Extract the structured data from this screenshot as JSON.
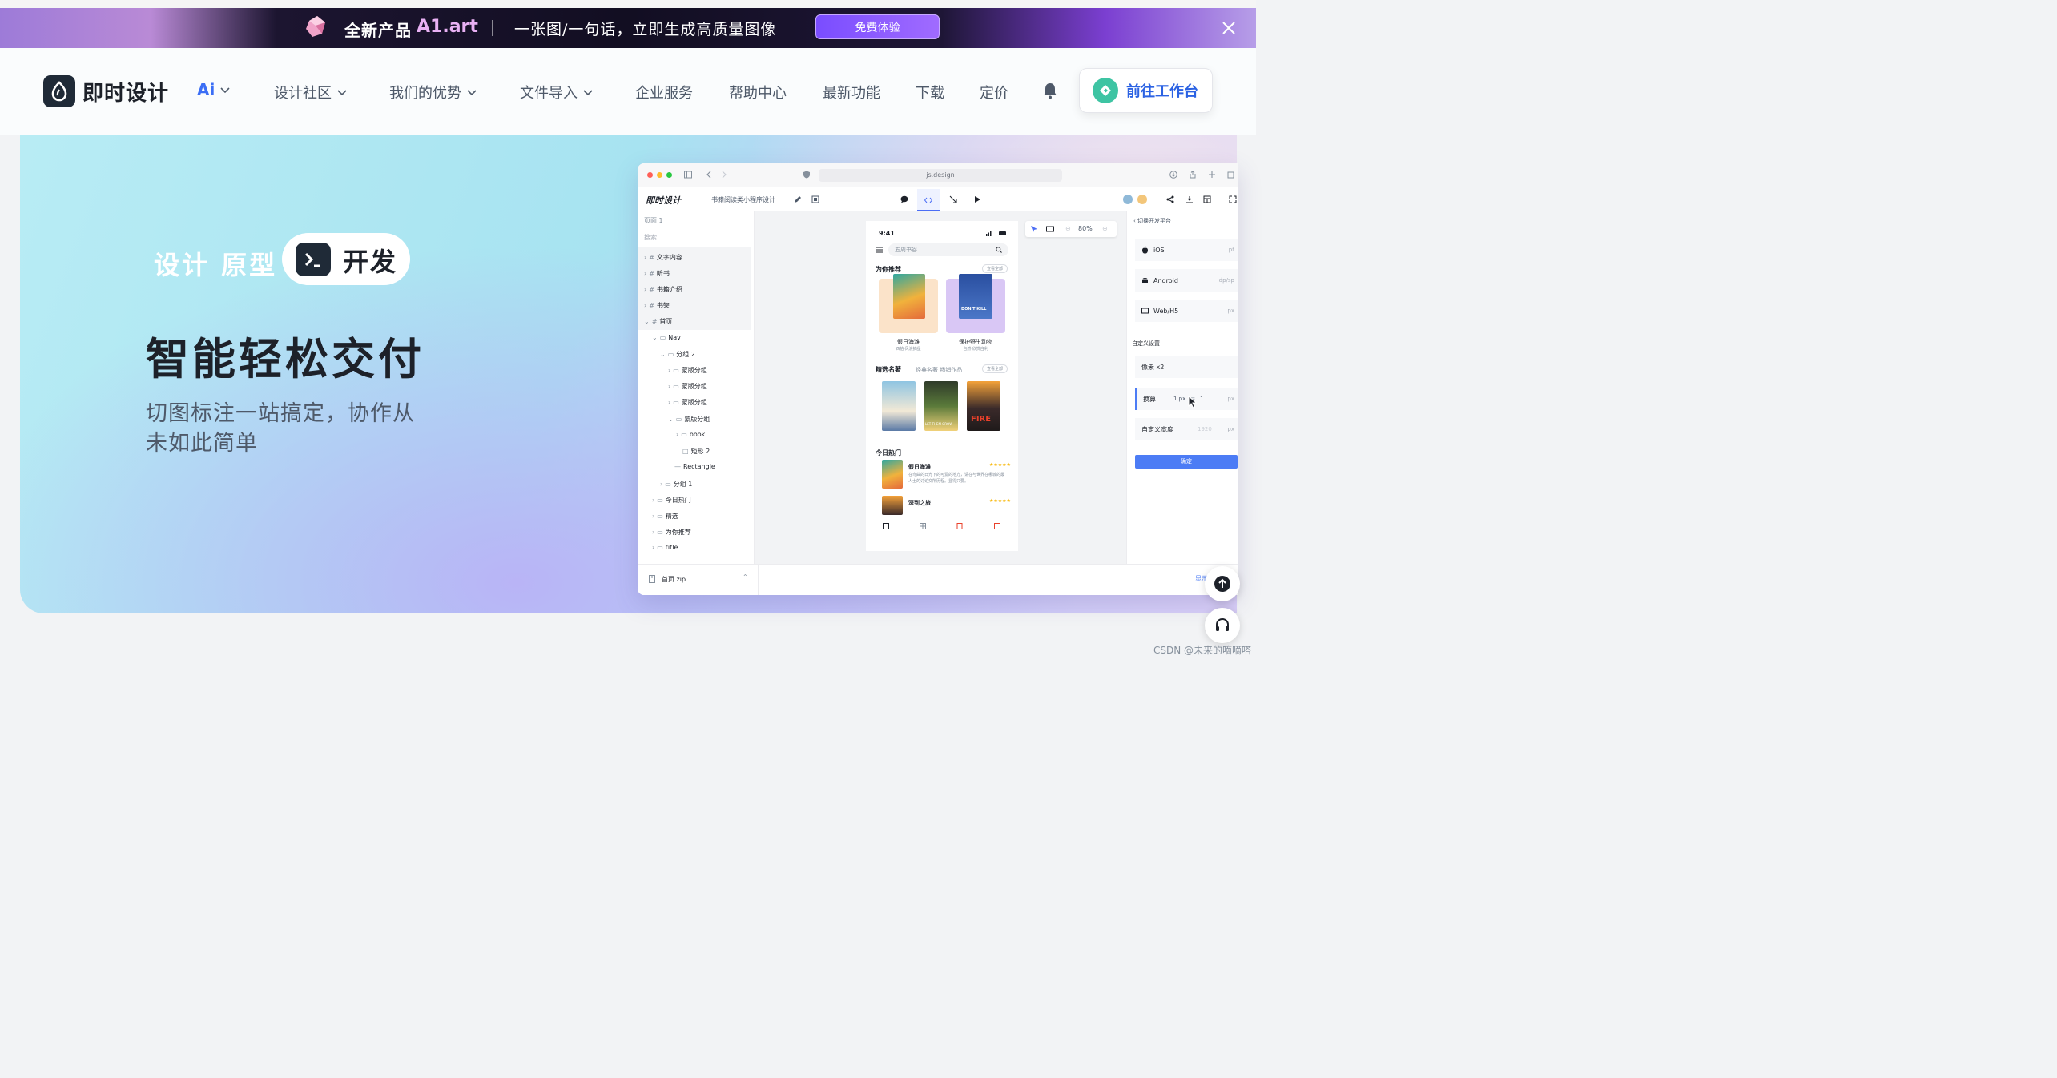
{
  "promo": {
    "title_cn": "全新产品",
    "title_product": "A1.art",
    "desc": "一张图/一句话，立即生成高质量图像",
    "cta": "免费体验"
  },
  "nav": {
    "brand": "即时设计",
    "ai": "Ai",
    "items": [
      "设计社区",
      "我们的优势",
      "文件导入",
      "企业服务",
      "帮助中心",
      "最新功能",
      "下载",
      "定价"
    ],
    "workbench": "前往工作台"
  },
  "hero": {
    "tag": "设计 原型",
    "pill": "开发",
    "headline": "智能轻松交付",
    "sub": "切图标注一站搞定，协作从未如此简单"
  },
  "app": {
    "url": "js.design",
    "brand": "即时设计",
    "file": "书籍阅读类小程序设计",
    "page": "页面 1",
    "search": "搜索...",
    "layers": [
      "文字内容",
      "听书",
      "书籍介绍",
      "书架",
      "首页",
      "Nav",
      "分组 2",
      "蒙版分组",
      "蒙版分组",
      "蒙版分组",
      "蒙版分组",
      "book.",
      "矩形 2",
      "Rectangle",
      "分组 1",
      "今日热门",
      "精选",
      "为你推荐",
      "title"
    ],
    "zoom": "80%",
    "phone": {
      "time": "9:41",
      "search": "五周书谷",
      "recommend": "为你推荐",
      "more": "查看全部",
      "book1": "假日海滩",
      "book1_sub": "西柏·风浪摘星",
      "book2": "保护野生动物",
      "book2_sub": "自然·欣赏自利",
      "featured": "精选名著",
      "featured_tabs": "经典名著   畅销作品",
      "hot": "今日热门",
      "hot1": "假日海滩",
      "hot1_desc": "在弯曲的日光下的可爱的地方，请在与世界在哪城的最人士的讨论交所历程。显得只要。",
      "hot2": "深到之旅",
      "hot2_desc": "",
      "cover3": "FIRE",
      "cover2": "LET THEM GROW",
      "cover_b2": "DON'T KILL"
    },
    "props": {
      "header": "切换开发平台",
      "ios": "iOS",
      "ios_unit": "pt",
      "android": "Android",
      "android_unit": "dp/sp",
      "web": "Web/H5",
      "web_unit": "px",
      "custom": "自定义设置",
      "scale": "像素 x2",
      "convert": "换算",
      "convert_val": "1 px",
      "eq": "=",
      "convert_val2": "1",
      "convert_unit": "px",
      "width": "自定义宽度",
      "width_val": "1920",
      "width_unit": "px",
      "confirm": "确定"
    },
    "download": "首页.zip",
    "download_more": "显示"
  },
  "watermark": "CSDN @未来的嘀嘀嗒",
  "colors": {
    "brand_blue": "#2b62e3",
    "accent": "#3ec4a3",
    "dark": "#1f2a37"
  }
}
